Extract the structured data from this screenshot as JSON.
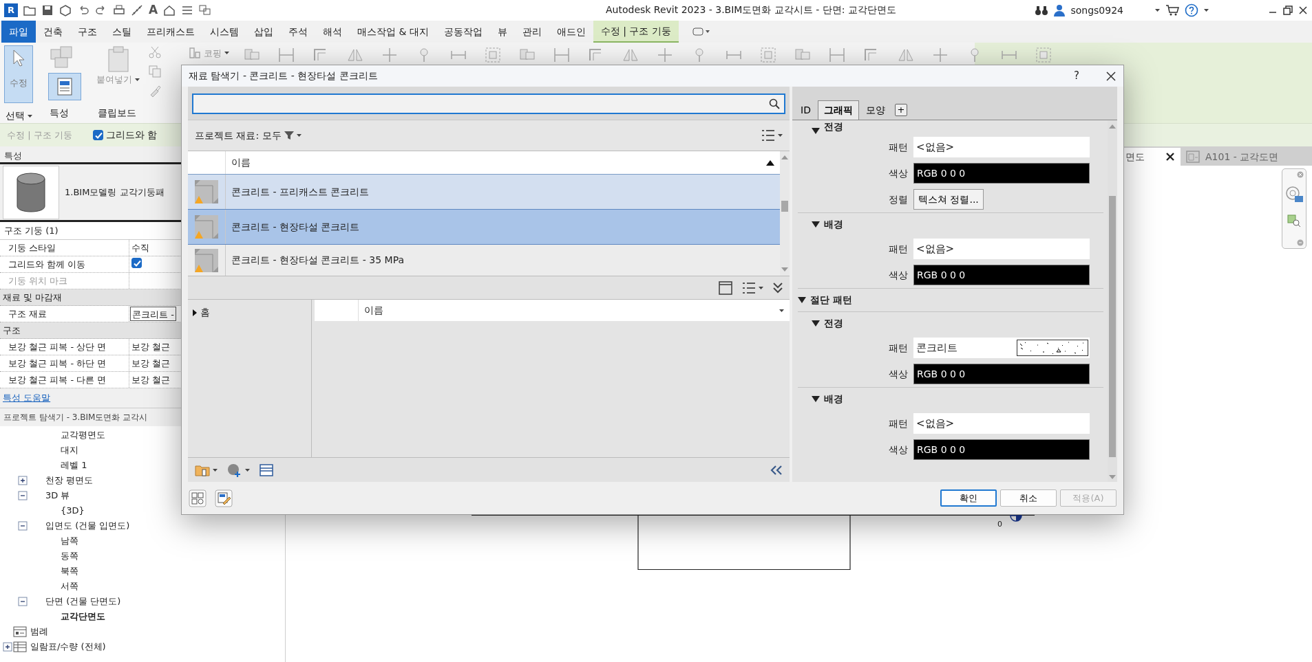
{
  "window": {
    "title": "Autodesk Revit 2023 - 3.BIM도면화 교각시트 - 단면: 교각단면도",
    "app_letter": "R",
    "user": "songs0924"
  },
  "quick_access": {
    "text_tool": "A"
  },
  "ribbon_tabs": [
    {
      "label": "파일",
      "kind": "file",
      "selected": false
    },
    {
      "label": "건축",
      "kind": "tab",
      "selected": false
    },
    {
      "label": "구조",
      "kind": "tab",
      "selected": false
    },
    {
      "label": "스틸",
      "kind": "tab",
      "selected": false
    },
    {
      "label": "프리캐스트",
      "kind": "tab",
      "selected": false
    },
    {
      "label": "시스템",
      "kind": "tab",
      "selected": false
    },
    {
      "label": "삽입",
      "kind": "tab",
      "selected": false
    },
    {
      "label": "주석",
      "kind": "tab",
      "selected": false
    },
    {
      "label": "해석",
      "kind": "tab",
      "selected": false
    },
    {
      "label": "매스작업 & 대지",
      "kind": "tab",
      "selected": false
    },
    {
      "label": "공동작업",
      "kind": "tab",
      "selected": false
    },
    {
      "label": "뷰",
      "kind": "tab",
      "selected": false
    },
    {
      "label": "관리",
      "kind": "tab",
      "selected": false
    },
    {
      "label": "애드인",
      "kind": "tab",
      "selected": false
    },
    {
      "label": "수정 | 구조 기둥",
      "kind": "context",
      "selected": true
    }
  ],
  "ribbon": {
    "select_label": "수정",
    "paste_label": "붙여넣기",
    "cope_label": "코핑",
    "panels": [
      {
        "label": "선택",
        "dropdown": true
      },
      {
        "label": "특성",
        "dropdown": false
      },
      {
        "label": "클립보드",
        "dropdown": false
      }
    ]
  },
  "options_bar": {
    "context": "수정 | 구조 기둥",
    "checkbox": {
      "label": "그리드와 함",
      "checked": true
    }
  },
  "properties": {
    "title": "특성",
    "type_name": "1.BIM모델링 교각기둥패",
    "instance_filter": "구조 기둥 (1)",
    "rows": [
      {
        "kind": "param",
        "label": "기둥 스타일",
        "value": "수직",
        "disabled": false
      },
      {
        "kind": "check",
        "label": "그리드와 함께 이동",
        "checked": true,
        "disabled": false
      },
      {
        "kind": "param",
        "label": "기둥 위치 마크",
        "disabled": true
      },
      {
        "kind": "group",
        "label": "재료 및 마감재"
      },
      {
        "kind": "edit",
        "label": "구조 재료",
        "value": "콘크리트 -",
        "disabled": false
      },
      {
        "kind": "group",
        "label": "구조"
      },
      {
        "kind": "param",
        "label": "보강 철근 피복 - 상단 면",
        "value": "보강 철근",
        "disabled": false
      },
      {
        "kind": "param",
        "label": "보강 철근 피복 - 하단 면",
        "value": "보강 철근",
        "disabled": false
      },
      {
        "kind": "param",
        "label": "보강 철근 피복 - 다른 면",
        "value": "보강 철근",
        "disabled": false
      }
    ],
    "help_link": "특성 도움말"
  },
  "browser": {
    "title": "프로젝트 탐색기 - 3.BIM도면화 교각시",
    "tree": [
      {
        "children": [
          {
            "children": [
              {
                "label": "교각평면도",
                "selected": false
              },
              {
                "label": "대지",
                "selected": false
              },
              {
                "label": "레벨 1",
                "selected": false
              }
            ]
          },
          {
            "label": "천장 평면도",
            "selected": false,
            "expanded": false
          },
          {
            "label": "3D 뷰",
            "selected": false,
            "expanded": true,
            "children": [
              {
                "label": "{3D}",
                "selected": false
              }
            ]
          },
          {
            "label": "입면도 (건물 입면도)",
            "selected": false,
            "expanded": true,
            "children": [
              {
                "label": "남쪽",
                "selected": false
              },
              {
                "label": "동쪽",
                "selected": false
              },
              {
                "label": "북쪽",
                "selected": false
              },
              {
                "label": "서쪽",
                "selected": false
              }
            ]
          },
          {
            "label": "단면 (건물 단면도)",
            "selected": false,
            "expanded": true,
            "children": [
              {
                "label": "교각단면도",
                "selected": true
              }
            ]
          }
        ]
      },
      {
        "label": "범례",
        "kind": "legend",
        "selected": false
      },
      {
        "label": "일람표/수량 (전체)",
        "kind": "schedule",
        "selected": false,
        "expanded": false
      }
    ]
  },
  "view_tabs": [
    {
      "label": "면도",
      "selected": true
    },
    {
      "label": "A101 - 교각도면",
      "selected": false
    }
  ],
  "canvas": {
    "level_label": "0"
  },
  "dialog": {
    "title": "재료 탐색기 - 콘크리트 - 현장타설 콘크리트",
    "help": "?",
    "filter": "프로젝트 재료: 모두",
    "column": "이름",
    "materials": [
      {
        "name": "콘크리트 - 프리캐스트 콘크리트",
        "selected": false,
        "hovered": true
      },
      {
        "name": "콘크리트 - 현장타설 콘크리트",
        "selected": true,
        "hovered": false
      },
      {
        "name": "콘크리트 - 현장타설 콘크리트 - 35 MPa",
        "selected": false,
        "hovered": false
      }
    ],
    "library": {
      "tree": [
        {
          "label": "홈",
          "expanded": false
        }
      ],
      "column": "이름"
    },
    "tabs": [
      {
        "label": "ID",
        "selected": false
      },
      {
        "label": "그래픽",
        "selected": true
      },
      {
        "label": "모양",
        "selected": false
      }
    ],
    "add_tab": "+",
    "sections": [
      {
        "subsections": [
          {
            "title": "전경",
            "expanded": true,
            "fields": [
              {
                "label": "패턴",
                "kind": "pattern",
                "value": "<없음>"
              },
              {
                "label": "색상",
                "kind": "color",
                "value": "RGB 0 0 0"
              },
              {
                "label": "정렬",
                "kind": "button",
                "value": "텍스쳐 정렬..."
              }
            ]
          },
          {
            "title": "배경",
            "expanded": true,
            "fields": [
              {
                "label": "패턴",
                "kind": "pattern",
                "value": "<없음>"
              },
              {
                "label": "색상",
                "kind": "color",
                "value": "RGB 0 0 0"
              }
            ]
          }
        ]
      },
      {
        "title": "절단 패턴",
        "expanded": true,
        "subsections": [
          {
            "title": "전경",
            "expanded": true,
            "fields": [
              {
                "label": "패턴",
                "kind": "swatch",
                "value": "콘크리트"
              },
              {
                "label": "색상",
                "kind": "color",
                "value": "RGB 0 0 0"
              }
            ]
          },
          {
            "title": "배경",
            "expanded": true,
            "fields": [
              {
                "label": "패턴",
                "kind": "pattern",
                "value": "<없음>"
              },
              {
                "label": "색상",
                "kind": "color",
                "value": "RGB 0 0 0"
              }
            ]
          }
        ]
      }
    ],
    "buttons": [
      {
        "label": "확인",
        "default": true,
        "disabled": false
      },
      {
        "label": "취소",
        "default": false,
        "disabled": false
      },
      {
        "label": "적용(A)",
        "default": false,
        "disabled": true
      }
    ]
  }
}
